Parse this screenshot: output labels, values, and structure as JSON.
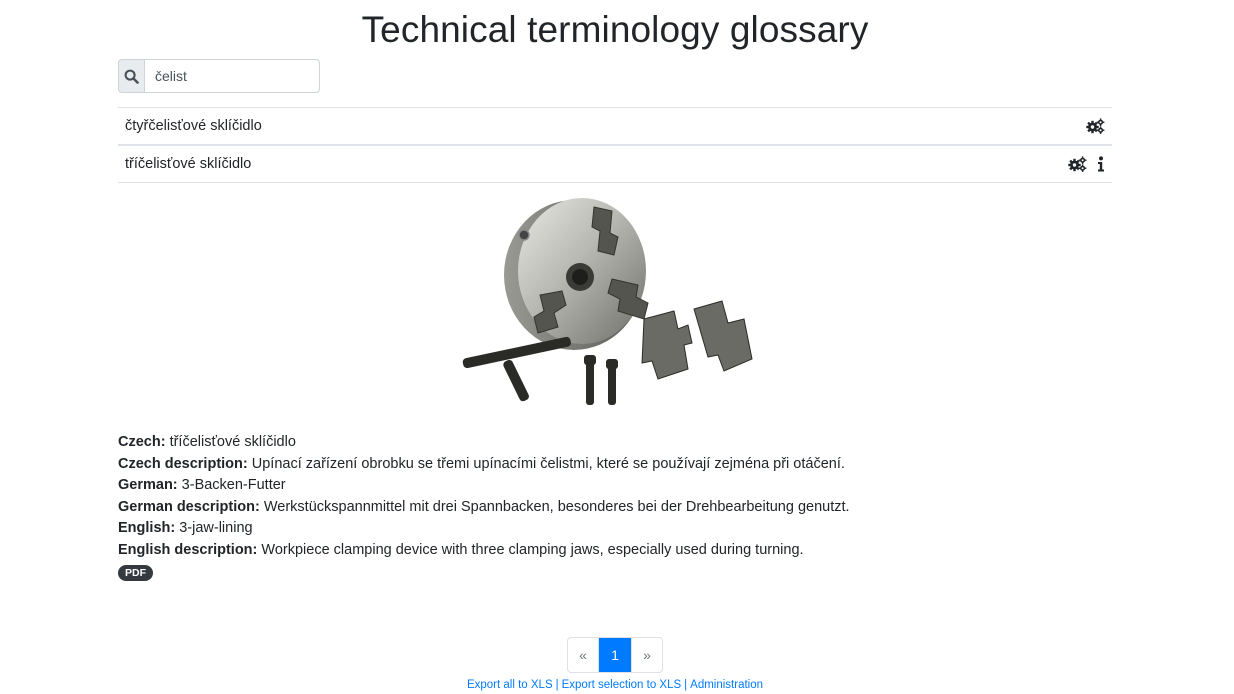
{
  "header": {
    "title": "Technical terminology glossary"
  },
  "search": {
    "value": "čelist",
    "icon": "search-icon"
  },
  "results": [
    {
      "label": "čtyřčelisťové sklíčidlo",
      "icons": [
        "gears-icon"
      ]
    },
    {
      "label": "tříčelisťové sklíčidlo",
      "icons": [
        "gears-icon",
        "info-icon"
      ]
    }
  ],
  "detail": {
    "image_alt": "three-jaw lathe chuck with jaws and keys",
    "czech_label": "Czech:",
    "czech": "tříčelisťové sklíčidlo",
    "czech_desc_label": "Czech description:",
    "czech_desc": "Upínací zařízení obrobku se třemi upínacími čelistmi, které se používají zejména při otáčení.",
    "german_label": "German:",
    "german": "3-Backen-Futter",
    "german_desc_label": "German description:",
    "german_desc": "Werkstückspannmittel mit drei Spannbacken, besonderes bei der Drehbearbeitung genutzt.",
    "english_label": "English:",
    "english": "3-jaw-lining",
    "english_desc_label": "English description:",
    "english_desc": "Workpiece clamping device with three clamping jaws, especially used during turning.",
    "pdf_label": "PDF"
  },
  "pagination": {
    "prev": "«",
    "current": "1",
    "next": "»"
  },
  "footer": {
    "export_all": "Export all to XLS",
    "export_selection": "Export selection to XLS",
    "administration": "Administration",
    "separator": "|"
  },
  "colors": {
    "accent": "#007bff",
    "badge": "#343a40",
    "border": "#dee2e6"
  }
}
